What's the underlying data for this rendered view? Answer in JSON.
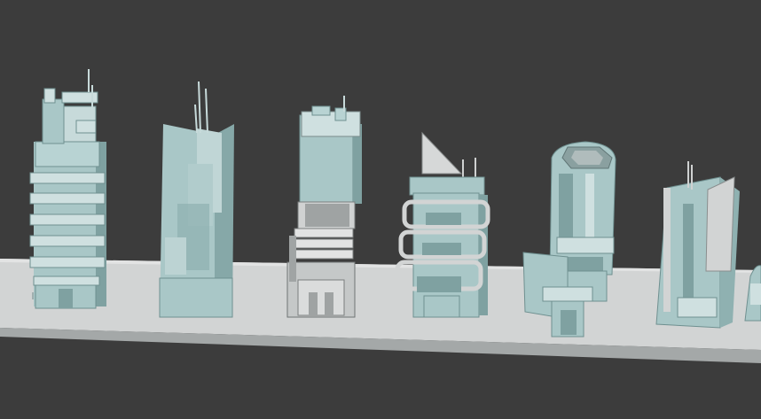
{
  "scene": {
    "background": "#3c3c3c",
    "ground_color": "#c9cbcb",
    "ground_shadow": "#8e9292",
    "building_main": "#a9c7c7",
    "building_dark": "#7fa1a1",
    "building_light": "#cfe0e0",
    "concrete_light": "#d7d8d8",
    "concrete_mid": "#b9bbbb",
    "concrete_dark": "#8f9393",
    "buildings": [
      {
        "name": "tower-stacked-floors",
        "kind": "stacked"
      },
      {
        "name": "tower-stepped-slab",
        "kind": "stepped"
      },
      {
        "name": "tower-grey-podium",
        "kind": "podium"
      },
      {
        "name": "tower-ringed-balconies",
        "kind": "ringed"
      },
      {
        "name": "tower-rounded-cylinder",
        "kind": "rounded"
      },
      {
        "name": "tower-angled-panels",
        "kind": "angled"
      },
      {
        "name": "tower-partial-offscreen",
        "kind": "partial"
      }
    ]
  }
}
